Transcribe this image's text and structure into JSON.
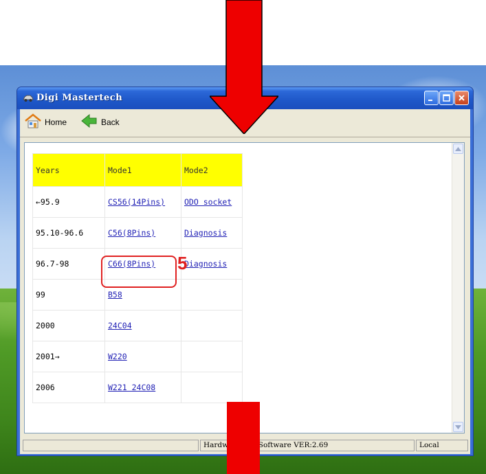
{
  "window": {
    "title": "Digi Mastertech"
  },
  "toolbar": {
    "home_label": "Home",
    "back_label": "Back"
  },
  "table": {
    "headers": [
      "Years",
      "Mode1",
      "Mode2"
    ],
    "rows": [
      {
        "years": "←95.9",
        "mode1": "CS56(14Pins)",
        "mode2": "ODO socket"
      },
      {
        "years": "95.10-96.6",
        "mode1": "C56(8Pins)",
        "mode2": "Diagnosis"
      },
      {
        "years": "96.7-98",
        "mode1": "C66(8Pins)",
        "mode2": "Diagnosis"
      },
      {
        "years": "99",
        "mode1": "B58",
        "mode2": ""
      },
      {
        "years": "2000",
        "mode1": "24C04",
        "mode2": ""
      },
      {
        "years": "2001→",
        "mode1": "W220",
        "mode2": ""
      },
      {
        "years": "2006",
        "mode1": "W221 24C08",
        "mode2": ""
      }
    ]
  },
  "annotation": {
    "step_number": "5",
    "color": "#e02020"
  },
  "statusbar": {
    "left": "",
    "middle": "Hardw                21230-  Software VER:2.69",
    "right": "Local"
  },
  "colors": {
    "header_bg": "#ffff00",
    "link": "#1f1fb4",
    "arrow": "#ee0000"
  },
  "icons": {
    "title": "car-icon",
    "home": "home-icon",
    "back": "back-arrow-icon"
  }
}
